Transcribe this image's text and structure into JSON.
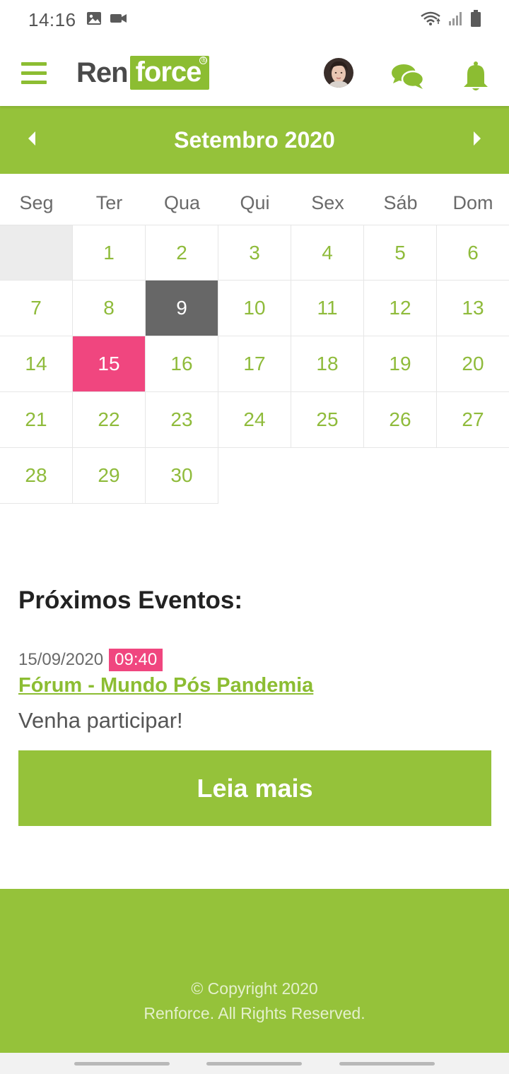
{
  "status_bar": {
    "time": "14:16",
    "icons": [
      "image-icon",
      "video-icon",
      "wifi-icon",
      "signal-icon",
      "battery-icon"
    ]
  },
  "header": {
    "logo_part1": "Ren",
    "logo_part2": "force",
    "logo_mark": "®",
    "icons": [
      "menu-icon",
      "avatar",
      "chat-icon",
      "bell-icon"
    ],
    "accent_color": "#95c23a"
  },
  "calendar": {
    "month_label": "Setembro 2020",
    "weekdays": [
      "Seg",
      "Ter",
      "Qua",
      "Qui",
      "Sex",
      "Sáb",
      "Dom"
    ],
    "today": 9,
    "event_day": 15,
    "today_color": "#676767",
    "event_color": "#f0467f",
    "weeks": [
      [
        "",
        "1",
        "2",
        "3",
        "4",
        "5",
        "6"
      ],
      [
        "7",
        "8",
        "9",
        "10",
        "11",
        "12",
        "13"
      ],
      [
        "14",
        "15",
        "16",
        "17",
        "18",
        "19",
        "20"
      ],
      [
        "21",
        "22",
        "23",
        "24",
        "25",
        "26",
        "27"
      ],
      [
        "28",
        "29",
        "30",
        "",
        "",
        "",
        ""
      ]
    ]
  },
  "events": {
    "title": "Próximos Eventos:",
    "items": [
      {
        "date": "15/09/2020",
        "time": "09:40",
        "name": "Fórum - Mundo Pós Pandemia",
        "description": "Venha participar!"
      }
    ],
    "read_more_label": "Leia mais"
  },
  "footer": {
    "line1": "© Copyright 2020",
    "line2": "Renforce. All Rights Reserved."
  }
}
